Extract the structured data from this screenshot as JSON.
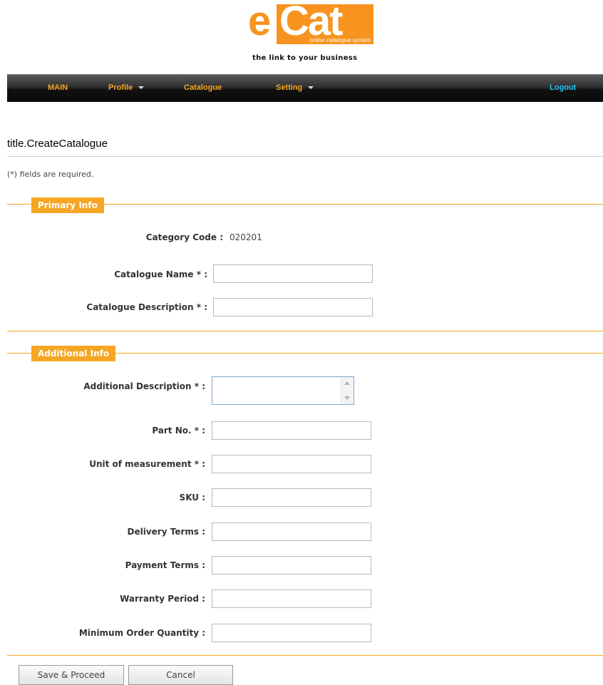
{
  "header": {
    "logo_e": "e",
    "logo_cat": "Cat",
    "logo_sub": "online catalogue system",
    "tagline": "the link to your business"
  },
  "nav": {
    "main": "MAIN",
    "profile": "Profile",
    "catalogue": "Catalogue",
    "setting": "Setting",
    "logout": "Logout"
  },
  "page": {
    "title": "title.CreateCatalogue",
    "required_note": "(*) fields are required."
  },
  "primary": {
    "heading": "Primary Info",
    "category_code_label": "Category Code",
    "colon": ":",
    "category_code_value": "020201",
    "catalogue_name_label": "Catalogue Name  * :",
    "catalogue_name_value": "",
    "catalogue_description_label": "Catalogue Description  * :",
    "catalogue_description_value": ""
  },
  "additional": {
    "heading": "Additional Info",
    "additional_description_label": "Additional Description  * :",
    "part_no_label": "Part No.  * :",
    "unit_label": "Unit of measurement  * :",
    "sku_label": "SKU :",
    "delivery_label": "Delivery Terms :",
    "payment_label": "Payment Terms :",
    "warranty_label": "Warranty Period :",
    "moq_label": "Minimum Order Quantity :"
  },
  "actions": {
    "save": "Save & Proceed",
    "cancel": "Cancel"
  },
  "colors": {
    "accent": "#f5a623",
    "logout": "#23c6f5"
  }
}
